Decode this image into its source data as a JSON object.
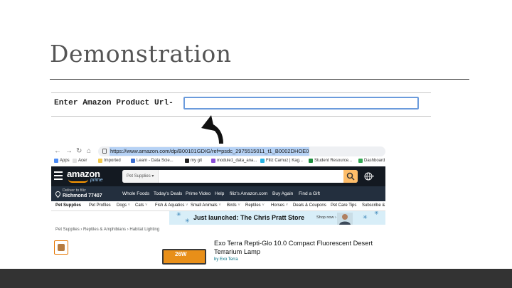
{
  "slide": {
    "title": "Demonstration"
  },
  "form": {
    "label": "Enter Amazon Product Url-",
    "input_value": "",
    "input_placeholder": ""
  },
  "browser": {
    "url": "https://www.amazon.com/dp/B00101GDIG/ref=psdc_2975515011_t1_B0002DHOE0",
    "bookmarks": [
      "Apps",
      "Acer",
      "Imported",
      "Learn - Data Scie...",
      "my git",
      "module1_data_ana...",
      "Filiz Camuz | Kag...",
      "Student Resource...",
      "Dashboard"
    ],
    "bookmark_colors": [
      "#4c8bf5",
      "#e0e0e0",
      "#f2c94c",
      "#3d6fd1",
      "#222222",
      "#8a4fd8",
      "#27b4e5",
      "#1e8e3e",
      "#34a853"
    ]
  },
  "amazon": {
    "logo": "amazon",
    "logo_sub": "prime",
    "search_category": "Pet Supplies",
    "deliver_line1": "Deliver to filiz",
    "deliver_line2": "Richmond 77407",
    "nav_links": [
      "Whole Foods",
      "Today's Deals",
      "Prime Video",
      "Help",
      "filiz's Amazon.com",
      "Buy Again",
      "Find a Gift"
    ],
    "categories": [
      "Pet Supplies",
      "Pet Profiles",
      "Dogs",
      "Cats",
      "Fish & Aquatics",
      "Small Animals",
      "Birds",
      "Reptiles",
      "Horses",
      "Deals & Coupons",
      "Pet Care Tips",
      "Subscribe & S"
    ],
    "promo_text": "Just launched: The Chris Pratt Store",
    "promo_shop": "Shop now",
    "breadcrumb": "Pet Supplies › Reptiles & Amphibians › Habitat Lighting",
    "product_badge": "26W",
    "product_title": "Exo Terra Repti-Glo 10.0 Compact Fluorescent Desert Terrarium Lamp",
    "byline": "by Exo Terra"
  },
  "colors": {
    "amazon_dark": "#131921",
    "amazon_nav": "#232f3e",
    "amazon_orange": "#ff9900",
    "search_button": "#febd69",
    "input_border": "#6b9bdc",
    "footer": "#333333"
  }
}
